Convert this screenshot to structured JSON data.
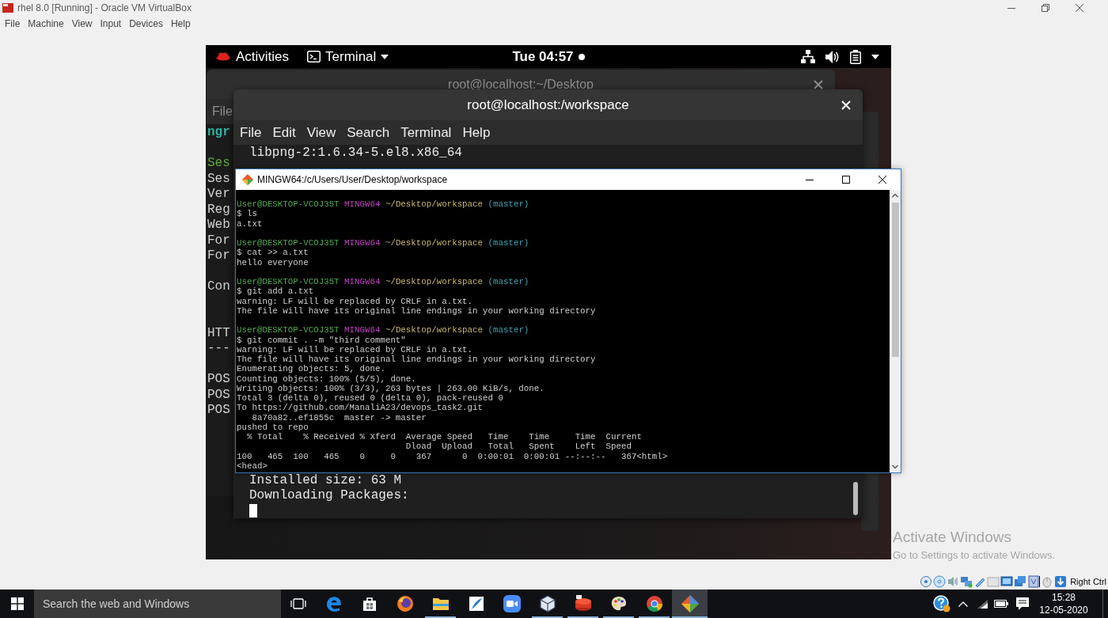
{
  "host_window": {
    "title": "rhel 8.0 [Running] - Oracle VM VirtualBox",
    "menu": [
      "File",
      "Machine",
      "View",
      "Input",
      "Devices",
      "Help"
    ]
  },
  "vm": {
    "top_bar": {
      "activities": "Activities",
      "app_menu": "Terminal",
      "clock": "Tue 04:57"
    },
    "desktop_window": {
      "title": "root@localhost:~/Desktop",
      "menu": [
        "File"
      ],
      "lines": [
        {
          "kind": "text",
          "text": "ngr",
          "color": "#2fb3a3"
        },
        {
          "kind": "blank"
        },
        {
          "kind": "text",
          "text": "Ses",
          "color": "#62a83a"
        },
        {
          "kind": "text",
          "text": "Ses",
          "color": "#d2d2d2"
        },
        {
          "kind": "text",
          "text": "Ver",
          "color": "#d2d2d2"
        },
        {
          "kind": "text",
          "text": "Reg",
          "color": "#d2d2d2"
        },
        {
          "kind": "text",
          "text": "Web",
          "color": "#d2d2d2"
        },
        {
          "kind": "text",
          "text": "For",
          "color": "#d2d2d2"
        },
        {
          "kind": "text",
          "text": "For",
          "color": "#d2d2d2"
        },
        {
          "kind": "blank"
        },
        {
          "kind": "text",
          "text": "Con",
          "color": "#d2d2d2"
        },
        {
          "kind": "blank"
        },
        {
          "kind": "blank"
        },
        {
          "kind": "text",
          "text": "HTT",
          "color": "#d2d2d2"
        },
        {
          "kind": "text",
          "text": "---",
          "color": "#d2d2d2"
        },
        {
          "kind": "blank"
        },
        {
          "kind": "text",
          "text": "POS",
          "color": "#d2d2d2"
        },
        {
          "kind": "text",
          "text": "POS",
          "color": "#d2d2d2"
        },
        {
          "kind": "text",
          "text": "POS",
          "color": "#d2d2d2"
        }
      ]
    },
    "front_terminal": {
      "title": "root@localhost:/workspace",
      "menu": [
        "File",
        "Edit",
        "View",
        "Search",
        "Terminal",
        "Help"
      ],
      "lines_above": [
        "libpng-2:1.6.34-5.el8.x86_64"
      ],
      "lines_below": [
        "Installed size: 63 M",
        "Downloading Packages:"
      ]
    }
  },
  "mingw_window": {
    "title": "MINGW64:/c/Users/User/Desktop/workspace",
    "lines": [
      {
        "kind": "prompt",
        "user": "User@DESKTOP-VCOJ35T",
        "shell": "MINGW64",
        "path": "~/Desktop/workspace",
        "branch": "(master)"
      },
      {
        "kind": "output",
        "text": "$ ls"
      },
      {
        "kind": "output",
        "text": "a.txt"
      },
      {
        "kind": "blank"
      },
      {
        "kind": "prompt",
        "user": "User@DESKTOP-VCOJ35T",
        "shell": "MINGW64",
        "path": "~/Desktop/workspace",
        "branch": "(master)"
      },
      {
        "kind": "output",
        "text": "$ cat >> a.txt"
      },
      {
        "kind": "output",
        "text": "hello everyone"
      },
      {
        "kind": "blank"
      },
      {
        "kind": "prompt",
        "user": "User@DESKTOP-VCOJ35T",
        "shell": "MINGW64",
        "path": "~/Desktop/workspace",
        "branch": "(master)"
      },
      {
        "kind": "output",
        "text": "$ git add a.txt"
      },
      {
        "kind": "output",
        "text": "warning: LF will be replaced by CRLF in a.txt."
      },
      {
        "kind": "output",
        "text": "The file will have its original line endings in your working directory"
      },
      {
        "kind": "blank"
      },
      {
        "kind": "prompt",
        "user": "User@DESKTOP-VCOJ35T",
        "shell": "MINGW64",
        "path": "~/Desktop/workspace",
        "branch": "(master)"
      },
      {
        "kind": "output",
        "text": "$ git commit . -m \"third comment\""
      },
      {
        "kind": "output",
        "text": "warning: LF will be replaced by CRLF in a.txt."
      },
      {
        "kind": "output",
        "text": "The file will have its original line endings in your working directory"
      },
      {
        "kind": "output",
        "text": "Enumerating objects: 5, done."
      },
      {
        "kind": "output",
        "text": "Counting objects: 100% (5/5), done."
      },
      {
        "kind": "output",
        "text": "Writing objects: 100% (3/3), 263 bytes | 263.00 KiB/s, done."
      },
      {
        "kind": "output",
        "text": "Total 3 (delta 0), reused 0 (delta 0), pack-reused 0"
      },
      {
        "kind": "output",
        "text": "To https://github.com/ManaliA23/devops_task2.git"
      },
      {
        "kind": "output",
        "text": "   8a70a82..ef1855c  master -> master"
      },
      {
        "kind": "output",
        "text": "pushed to repo"
      },
      {
        "kind": "output",
        "text": "  % Total    % Received % Xferd  Average Speed   Time    Time     Time  Current"
      },
      {
        "kind": "output",
        "text": "                                 Dload  Upload   Total   Spent    Left  Speed"
      },
      {
        "kind": "output",
        "text": "100   465  100   465    0     0    367      0  0:00:01  0:00:01 --:--:--   367<html>"
      },
      {
        "kind": "output",
        "text": "<head>"
      }
    ]
  },
  "activation_notice": {
    "title": "Activate Windows",
    "text": "Go to Settings to activate Windows."
  },
  "status_bar": {
    "host_key": "Right Ctrl"
  },
  "taskbar": {
    "search": {
      "placeholder": "Search the web and Windows"
    },
    "apps": [
      {
        "kind": "edge",
        "selected": false,
        "running": false
      },
      {
        "kind": "store",
        "selected": false,
        "running": false
      },
      {
        "kind": "firefox",
        "selected": false,
        "running": false
      },
      {
        "kind": "files",
        "selected": false,
        "running": true
      },
      {
        "kind": "feather",
        "selected": false,
        "running": false
      },
      {
        "kind": "zoom",
        "selected": false,
        "running": false
      },
      {
        "kind": "virtualbox",
        "selected": false,
        "running": true
      },
      {
        "kind": "vm",
        "selected": false,
        "running": true
      },
      {
        "kind": "paint",
        "selected": false,
        "running": true
      },
      {
        "kind": "chrome",
        "selected": false,
        "running": true
      },
      {
        "kind": "git",
        "selected": true,
        "running": true
      }
    ],
    "clock": {
      "time": "15:28",
      "date": "12-05-2020"
    }
  }
}
